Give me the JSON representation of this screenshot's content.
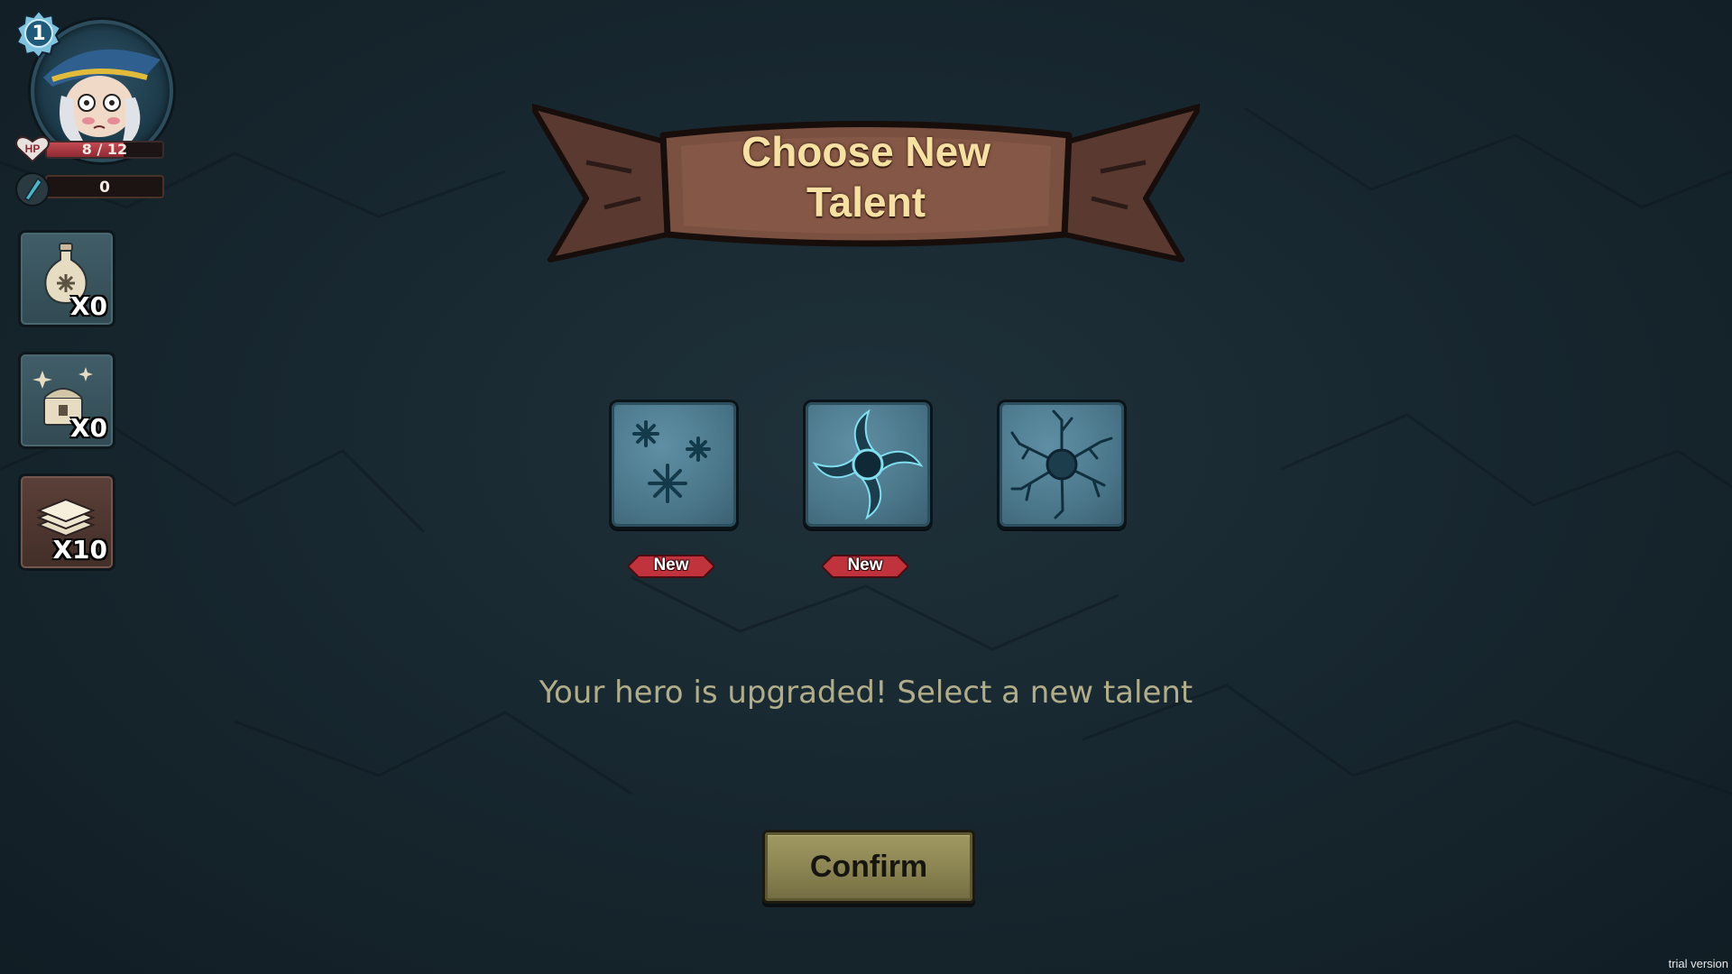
{
  "hero": {
    "level": "1",
    "hp_label": "HP",
    "hp_text": "8 / 12",
    "hp_fraction": 0.667,
    "mana_text": "0"
  },
  "inventory": [
    {
      "icon": "potion-icon",
      "count": "X0",
      "style": "blue"
    },
    {
      "icon": "treasure-chest-icon",
      "count": "X0",
      "style": "blue"
    },
    {
      "icon": "card-stack-icon",
      "count": "X10",
      "style": "brown"
    }
  ],
  "banner": {
    "title_line1": "Choose New",
    "title_line2": "Talent"
  },
  "talents": [
    {
      "icon": "snowflakes-icon",
      "badge": "New"
    },
    {
      "icon": "vortex-icon",
      "badge": "New"
    },
    {
      "icon": "shatter-icon",
      "badge": ""
    }
  ],
  "message": "Your hero is upgraded! Select a new talent",
  "confirm_label": "Confirm",
  "watermark": "trial version",
  "colors": {
    "background": "#182830",
    "banner_wood": "#7a5141",
    "title_text": "#f6e1a2",
    "message_text": "#b1ad89",
    "new_badge": "#c0323c",
    "confirm_button": "#8a8452"
  }
}
